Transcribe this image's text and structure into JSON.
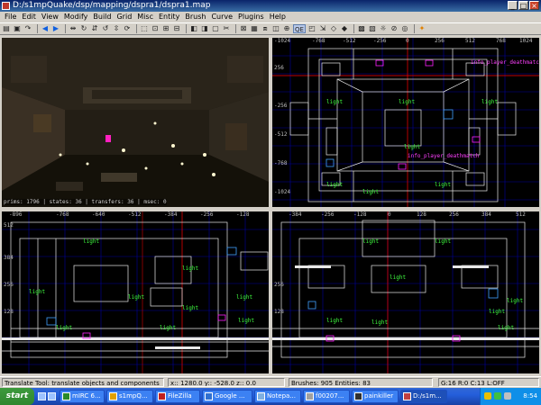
{
  "window": {
    "title": "D:/s1mpQuake/dsp/mapping/dspra1/dspra1.map"
  },
  "menu": [
    "File",
    "Edit",
    "View",
    "Modify",
    "Build",
    "Grid",
    "Misc",
    "Entity",
    "Brush",
    "Curve",
    "Plugins",
    "Help"
  ],
  "toolbar": {
    "qe_label": "QE"
  },
  "camera": {
    "status": "prims: 1796 | states: 36 | transfers: 36 | msec: 0"
  },
  "top_view": {
    "ruler_top": [
      "-1024",
      "-768",
      "-512",
      "-256",
      "0",
      "256",
      "512",
      "768",
      "1024"
    ],
    "ruler_left": [
      "256",
      "-256",
      "-512",
      "-768",
      "-1024"
    ],
    "labels": [
      "light",
      "light",
      "light",
      "light",
      "light",
      "light",
      "light",
      "info_player_deathmatch",
      "info_player_deathmatch"
    ]
  },
  "front_view": {
    "ruler_top": [
      "-896",
      "-768",
      "-640",
      "-512",
      "-384",
      "-256",
      "-128"
    ],
    "ruler_left": [
      "512",
      "384",
      "256",
      "128"
    ],
    "labels": [
      "light",
      "light",
      "light",
      "light",
      "light",
      "light",
      "light",
      "light",
      "light"
    ]
  },
  "side_view": {
    "ruler_top": [
      "-384",
      "-256",
      "-128",
      "0",
      "128",
      "256",
      "384",
      "512"
    ],
    "ruler_left": [
      "256",
      "128"
    ],
    "labels": [
      "light",
      "light",
      "light",
      "light",
      "light",
      "light",
      "light",
      "light"
    ]
  },
  "status": {
    "tool": "Translate Tool: translate objects and components",
    "coords": "x:: 1280.0  y:: -528.0  z::  0.0",
    "counts": "Brushes: 905  Entities: 83",
    "grid": "G:16  R:0  C:13  L:OFF"
  },
  "taskbar": {
    "start": "start",
    "tasks": [
      {
        "label": "mIRC 6...",
        "color": "#2a8a2a"
      },
      {
        "label": "s1mpQ...",
        "color": "#e0a000"
      },
      {
        "label": "FileZilla",
        "color": "#c02020"
      },
      {
        "label": "Google ...",
        "color": "#3070d0"
      },
      {
        "label": "Notepa...",
        "color": "#80b0e0"
      },
      {
        "label": "f00207...",
        "color": "#a0a0a0"
      },
      {
        "label": "painkiller",
        "color": "#303030"
      },
      {
        "label": "D:/s1m...",
        "color": "#c04040"
      }
    ],
    "clock": "8:54"
  },
  "colors": {
    "grid_blue": "#0000a0",
    "brush_white": "#e8e8e8",
    "entity_green": "#40ff40",
    "axis_red": "#ff0000"
  }
}
